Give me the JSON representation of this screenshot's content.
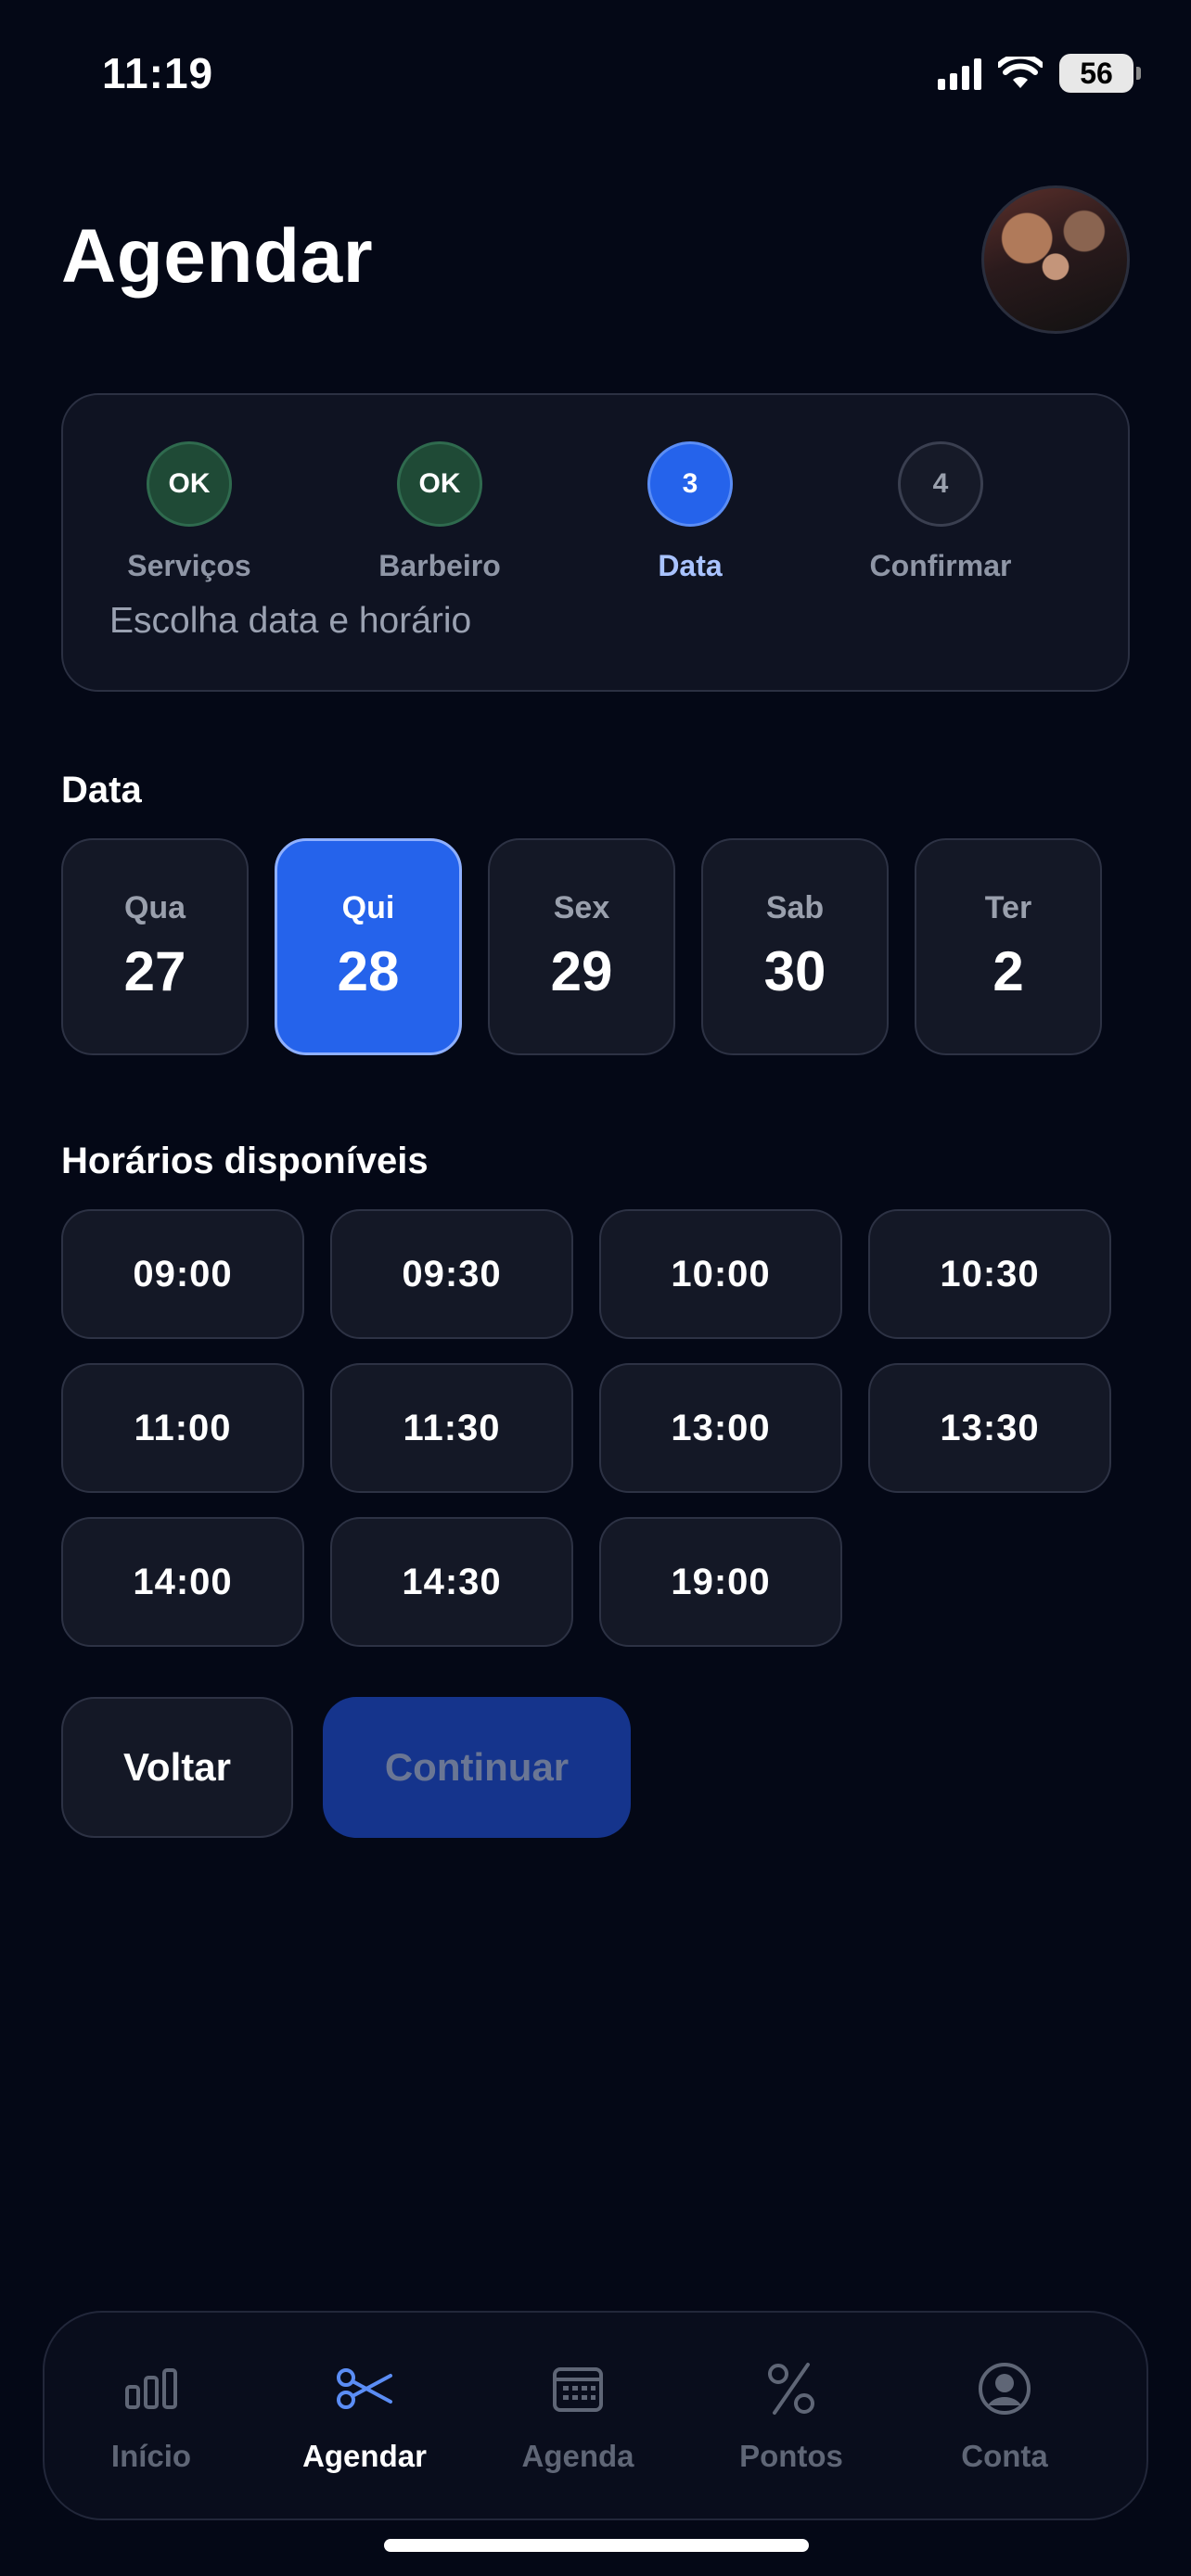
{
  "status_bar": {
    "time": "11:19",
    "battery": "56"
  },
  "header": {
    "title": "Agendar"
  },
  "stepper": {
    "steps": [
      {
        "badge": "OK",
        "label": "Serviços",
        "state": "done"
      },
      {
        "badge": "OK",
        "label": "Barbeiro",
        "state": "done"
      },
      {
        "badge": "3",
        "label": "Data",
        "state": "active"
      },
      {
        "badge": "4",
        "label": "Confirmar",
        "state": "todo"
      }
    ],
    "hint": "Escolha data e horário"
  },
  "date_section": {
    "label": "Data",
    "dates": [
      {
        "dow": "Qua",
        "day": "27"
      },
      {
        "dow": "Qui",
        "day": "28",
        "selected": true
      },
      {
        "dow": "Sex",
        "day": "29"
      },
      {
        "dow": "Sab",
        "day": "30"
      },
      {
        "dow": "Ter",
        "day": "2"
      }
    ]
  },
  "times_section": {
    "label": "Horários disponíveis",
    "slots": [
      "09:00",
      "09:30",
      "10:00",
      "10:30",
      "11:00",
      "11:30",
      "13:00",
      "13:30",
      "14:00",
      "14:30",
      "19:00"
    ]
  },
  "actions": {
    "back_label": "Voltar",
    "continue_label": "Continuar"
  },
  "tabbar": {
    "tabs": [
      {
        "label": "Início",
        "icon": "bar-chart-icon"
      },
      {
        "label": "Agendar",
        "icon": "scissors-icon",
        "active": true
      },
      {
        "label": "Agenda",
        "icon": "calendar-icon"
      },
      {
        "label": "Pontos",
        "icon": "percent-icon"
      },
      {
        "label": "Conta",
        "icon": "account-icon"
      }
    ]
  },
  "colors": {
    "background": "#040816",
    "accent": "#2563eb",
    "done": "#1f4a36",
    "card": "#141826"
  }
}
